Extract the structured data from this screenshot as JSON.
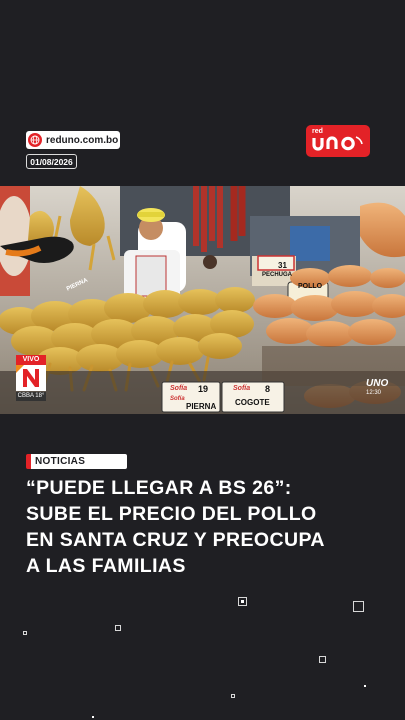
{
  "header": {
    "site_url": "reduno.com.bo",
    "date": "01/08/2026",
    "logo_small": "red",
    "logo_main": "UNO"
  },
  "video": {
    "live_label": "VIVO",
    "live_city": "CBBA 18°",
    "corner_logo": "UNO",
    "corner_time": "12:30",
    "signs": [
      "31",
      "PECHUGA",
      "POLLO",
      "Sofía",
      "19",
      "Sofía",
      "8",
      "COGOTE",
      "Sofía",
      "PIERNA",
      "PIERNA"
    ]
  },
  "article": {
    "section": "NOTICIAS",
    "headline_lines": [
      "“PUEDE LLEGAR A BS 26”:",
      "SUBE EL PRECIO DEL POLLO",
      "EN SANTA CRUZ Y PREOCUPA",
      "A LAS FAMILIAS"
    ]
  },
  "colors": {
    "background": "#1f1f23",
    "accent": "#e32227",
    "text": "#ffffff"
  }
}
